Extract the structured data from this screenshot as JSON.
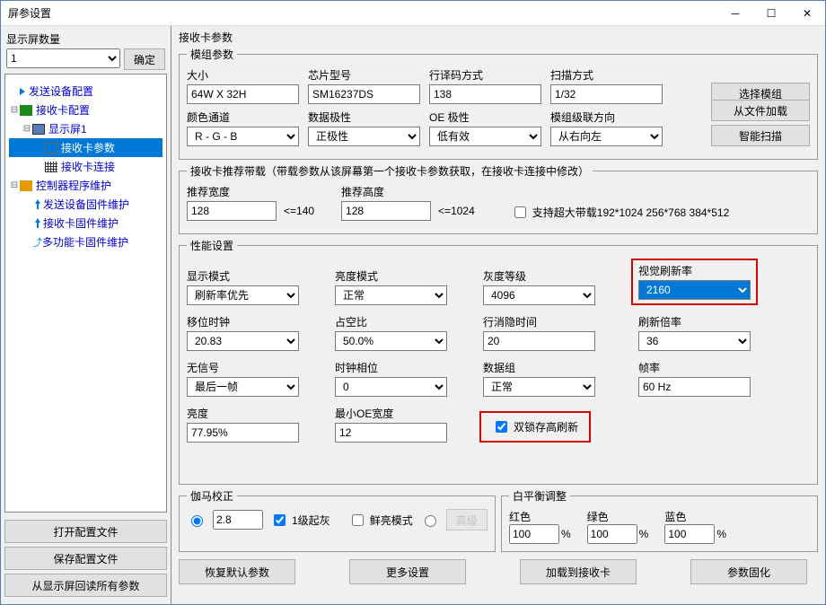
{
  "window": {
    "title": "屏参设置"
  },
  "sidebar": {
    "label": "显示屏数量",
    "count_value": "1",
    "confirm": "确定",
    "tree": {
      "send_cfg": "发送设备配置",
      "recv_cfg": "接收卡配置",
      "screen1": "显示屏1",
      "recv_params": "接收卡参数",
      "recv_conn": "接收卡连接",
      "ctrl_maint": "控制器程序维护",
      "send_fw": "发送设备固件维护",
      "recv_fw": "接收卡固件维护",
      "multi_fw": "多功能卡固件维护"
    },
    "buttons": {
      "open_cfg": "打开配置文件",
      "save_cfg": "保存配置文件",
      "read_all": "从显示屏回读所有参数"
    }
  },
  "main": {
    "title": "接收卡参数",
    "module": {
      "legend": "模组参数",
      "size_label": "大小",
      "size": "64W X 32H",
      "chip_label": "芯片型号",
      "chip": "SM16237DS",
      "decode_label": "行译码方式",
      "decode": "138",
      "scan_label": "扫描方式",
      "scan": "1/32",
      "color_label": "颜色通道",
      "color": "R - G - B",
      "datapol_label": "数据极性",
      "datapol": "正极性",
      "oe_label": "OE 极性",
      "oe": "低有效",
      "cascade_label": "模组级联方向",
      "cascade": "从右向左",
      "btn_select": "选择模组",
      "btn_load": "从文件加载",
      "btn_smart": "智能扫描"
    },
    "rec": {
      "legend": "接收卡推荐带载（带载参数从该屏幕第一个接收卡参数获取，在接收卡连接中修改）",
      "w_label": "推荐宽度",
      "w": "128",
      "w_max": "<=140",
      "h_label": "推荐高度",
      "h": "128",
      "h_max": "<=1024",
      "big_label": "支持超大带载192*1024 256*768 384*512"
    },
    "perf": {
      "legend": "性能设置",
      "disp_mode_label": "显示模式",
      "disp_mode": "刷新率优先",
      "bright_mode_label": "亮度模式",
      "bright_mode": "正常",
      "gray_label": "灰度等级",
      "gray": "4096",
      "refresh_label": "视觉刷新率",
      "refresh": "2160",
      "shift_label": "移位时钟",
      "shift": "20.83",
      "duty_label": "占空比",
      "duty": "50.0%",
      "blank_label": "行消隐时间",
      "blank": "20",
      "mult_label": "刷新倍率",
      "mult": "36",
      "nosig_label": "无信号",
      "nosig": "最后一帧",
      "phase_label": "时钟相位",
      "phase": "0",
      "group_label": "数据组",
      "group": "正常",
      "fps_label": "帧率",
      "fps": "60 Hz",
      "lum_label": "亮度",
      "lum": "77.95%",
      "minoe_label": "最小OE宽度",
      "minoe": "12",
      "dbl_label": "双锁存高刷新"
    },
    "gamma": {
      "legend": "伽马校正",
      "val": "2.8",
      "one_level": "1级起灰",
      "vivid": "鲜亮模式",
      "adv": "高级"
    },
    "wb": {
      "legend": "白平衡调整",
      "r": "红色",
      "g": "绿色",
      "b": "蓝色",
      "rv": "100",
      "gv": "100",
      "bv": "100",
      "pct": "%"
    },
    "bottom": {
      "restore": "恢复默认参数",
      "more": "更多设置",
      "load": "加载到接收卡",
      "fix": "参数固化"
    }
  }
}
